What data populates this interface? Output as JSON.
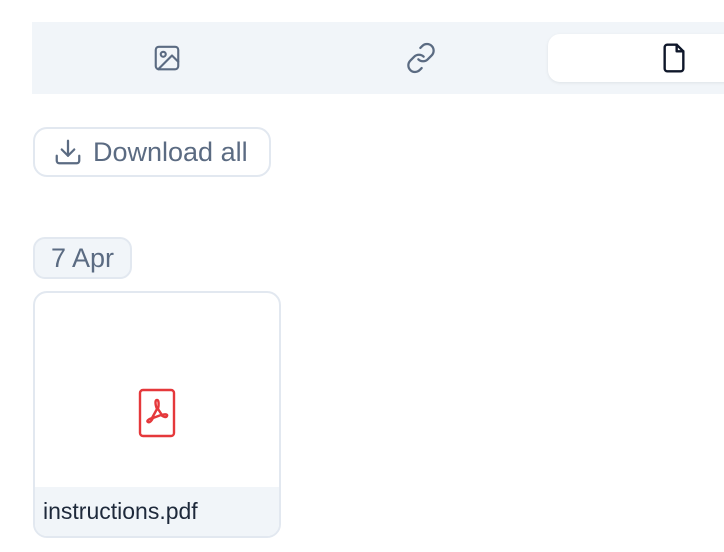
{
  "tabs": [
    {
      "name": "images",
      "icon": "image-icon",
      "selected": false
    },
    {
      "name": "links",
      "icon": "link-icon",
      "selected": false
    },
    {
      "name": "files",
      "icon": "file-icon",
      "selected": true
    }
  ],
  "actions": {
    "download_all_label": "Download all",
    "download_icon": "download-icon"
  },
  "groups": [
    {
      "date_label": "7 Apr",
      "files": [
        {
          "name": "instructions.pdf",
          "icon": "pdf-icon"
        }
      ]
    }
  ],
  "colors": {
    "tab_bar_bg": "#f1f5f9",
    "muted_text": "#5b6b82",
    "border": "#e2e8f0",
    "pdf_red": "#e5383b",
    "dark_text": "#1e293b"
  }
}
